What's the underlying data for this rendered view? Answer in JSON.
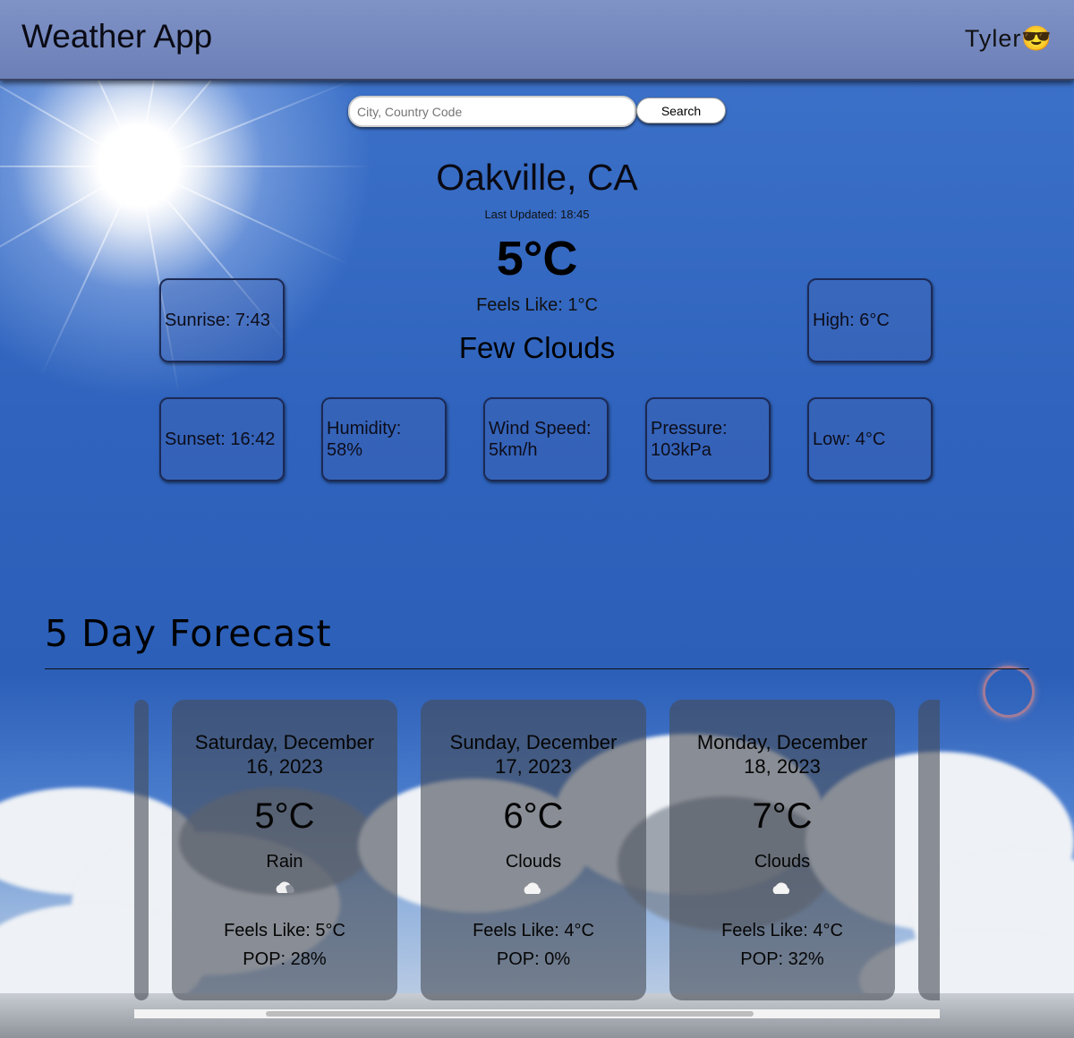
{
  "app": {
    "title": "Weather App",
    "user": "Tyler😎"
  },
  "search": {
    "placeholder": "City, Country Code",
    "button": "Search"
  },
  "current": {
    "city": "Oakville, CA",
    "last_updated": "Last Updated: 18:45",
    "temperature": "5°C",
    "feels_like": "Feels Like: 1°C",
    "description": "Few Clouds"
  },
  "stats": {
    "sunrise": "Sunrise: 7:43",
    "sunset": "Sunset: 16:42",
    "humidity_label": "Humidity:",
    "humidity_value": "58%",
    "wind_label": "Wind Speed:",
    "wind_value": "5km/h",
    "pressure_label": "Pressure:",
    "pressure_value": "103kPa",
    "high": "High: 6°C",
    "low": "Low: 4°C"
  },
  "forecast": {
    "title": "5 Day Forecast",
    "days": [
      {
        "date_line1": "Saturday, December",
        "date_line2": "16, 2023",
        "temp": "5°C",
        "desc": "Rain",
        "icon": "cloud-rain-icon",
        "feels": "Feels Like: 5°C",
        "pop": "POP: 28%"
      },
      {
        "date_line1": "Sunday, December",
        "date_line2": "17, 2023",
        "temp": "6°C",
        "desc": "Clouds",
        "icon": "broken-clouds-icon",
        "feels": "Feels Like: 4°C",
        "pop": "POP: 0%"
      },
      {
        "date_line1": "Monday, December",
        "date_line2": "18, 2023",
        "temp": "7°C",
        "desc": "Clouds",
        "icon": "cloud-icon",
        "feels": "Feels Like: 4°C",
        "pop": "POP: 32%"
      }
    ]
  }
}
